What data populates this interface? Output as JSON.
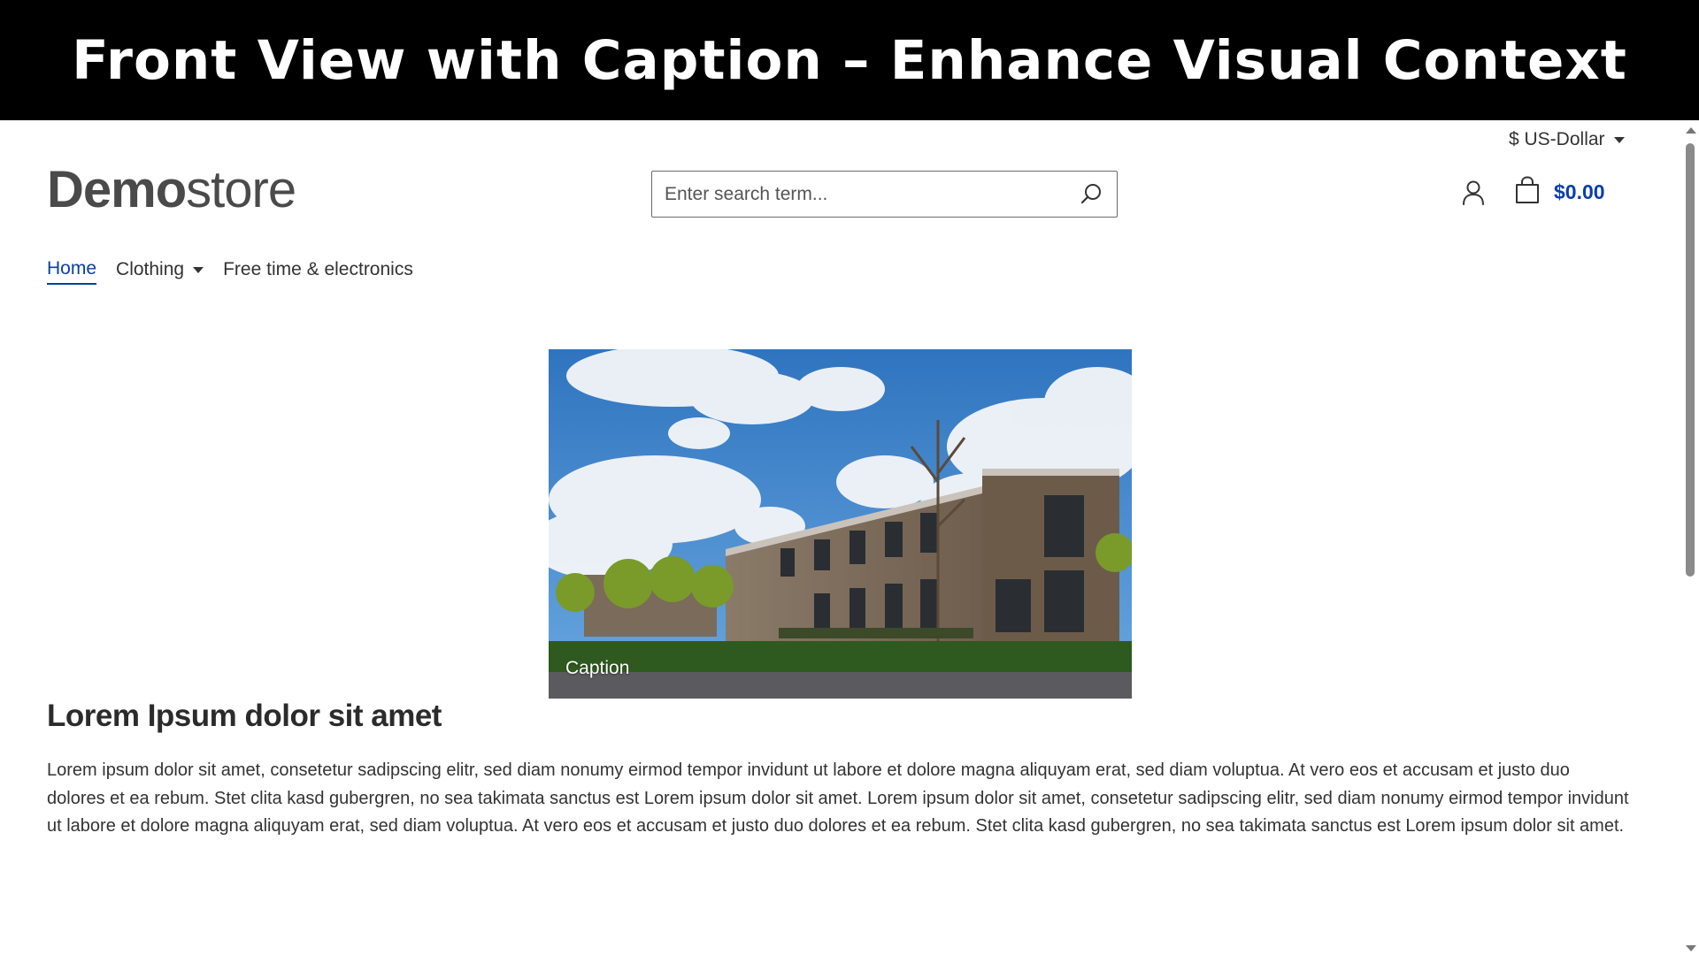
{
  "banner": {
    "title": "Front View with Caption – Enhance Visual Context"
  },
  "header": {
    "currency_label": "$ US-Dollar",
    "logo_bold": "Demo",
    "logo_light": "store",
    "search_placeholder": "Enter search term...",
    "cart_total": "$0.00"
  },
  "nav": {
    "items": [
      {
        "label": "Home",
        "active": true
      },
      {
        "label": "Clothing",
        "has_dropdown": true
      },
      {
        "label": "Free time & electronics"
      }
    ]
  },
  "content": {
    "image_caption": "Caption",
    "heading": "Lorem Ipsum dolor sit amet",
    "paragraph": "Lorem ipsum dolor sit amet, consetetur sadipscing elitr, sed diam nonumy eirmod tempor invidunt ut labore et dolore magna aliquyam erat, sed diam voluptua. At vero eos et accusam et justo duo dolores et ea rebum. Stet clita kasd gubergren, no sea takimata sanctus est Lorem ipsum dolor sit amet. Lorem ipsum dolor sit amet, consetetur sadipscing elitr, sed diam nonumy eirmod tempor invidunt ut labore et dolore magna aliquyam erat, sed diam voluptua. At vero eos et accusam et justo duo dolores et ea rebum. Stet clita kasd gubergren, no sea takimata sanctus est Lorem ipsum dolor sit amet."
  },
  "colors": {
    "accent": "#0b3fa8",
    "banner_bg": "#000000"
  },
  "icons": {
    "search": "search-icon",
    "account": "user-icon",
    "cart": "shopping-bag-icon"
  }
}
